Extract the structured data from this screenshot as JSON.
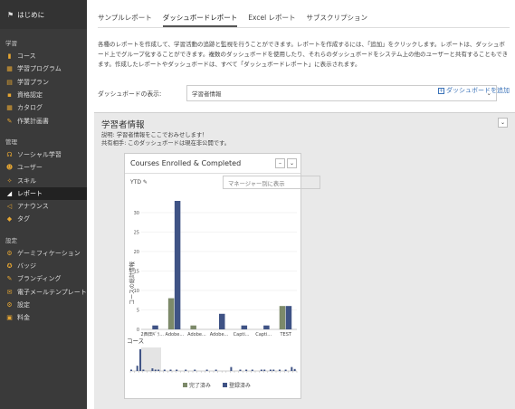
{
  "sidebar": {
    "home_label": "はじめに",
    "sections": [
      {
        "title": "学習",
        "items": [
          {
            "label": "コース",
            "icon": "book-icon"
          },
          {
            "label": "学習プログラム",
            "icon": "program-icon"
          },
          {
            "label": "学習プラン",
            "icon": "plan-icon"
          },
          {
            "label": "資格認定",
            "icon": "certificate-icon"
          },
          {
            "label": "カタログ",
            "icon": "catalog-icon"
          },
          {
            "label": "作業計画書",
            "icon": "pin-icon"
          }
        ]
      },
      {
        "title": "管理",
        "items": [
          {
            "label": "ソーシャル学習",
            "icon": "social-icon"
          },
          {
            "label": "ユーザー",
            "icon": "users-icon"
          },
          {
            "label": "スキル",
            "icon": "skills-icon"
          },
          {
            "label": "レポート",
            "icon": "report-icon",
            "active": true
          },
          {
            "label": "アナウンス",
            "icon": "announce-icon"
          },
          {
            "label": "タグ",
            "icon": "tag-icon"
          }
        ]
      },
      {
        "title": "設定",
        "items": [
          {
            "label": "ゲーミフィケーション",
            "icon": "gamification-icon"
          },
          {
            "label": "バッジ",
            "icon": "badge-icon"
          },
          {
            "label": "ブランディング",
            "icon": "branding-icon"
          },
          {
            "label": "電子メールテンプレート",
            "icon": "email-icon"
          },
          {
            "label": "設定",
            "icon": "settings-icon"
          },
          {
            "label": "料金",
            "icon": "billing-icon"
          }
        ]
      }
    ]
  },
  "tabs": [
    "サンプルレポート",
    "ダッシュボードレポート",
    "Excel レポート",
    "サブスクリプション"
  ],
  "active_tab": 1,
  "description": "各種のレポートを作成して、学習活動の追跡と監視を行うことができます。レポートを作成するには、「追加」をクリックします。レポートは、ダッシュボード上でグループ化することができます。複数のダッシュボードを使用したり、それらのダッシュボードをシステム上の他のユーザーと共有することもできます。作成したレポートやダッシュボードは、すべて「ダッシュボードレポート」に表示されます。",
  "dashboard_select": {
    "label": "ダッシュボードの表示:",
    "value": "学習者情報"
  },
  "add_dashboard": "ダッシュボードを追加",
  "panel": {
    "title": "学習者情報",
    "description": "説明: 学習者情報をここでおみせします！",
    "shared": "共有相手: このダッシュボードは現在非公開です。"
  },
  "widget": {
    "title": "Courses Enrolled & Completed",
    "period": "YTD",
    "filter_placeholder": "マネージャー別に表示"
  },
  "colors": {
    "completed": "#7d8a6a",
    "enrolled": "#3f5385",
    "accent_icon": "#e6a632",
    "link": "#3a72b8"
  },
  "chart_data": {
    "type": "bar",
    "xlabel": "コース",
    "ylabel": "コースの総計情報",
    "ylim": [
      0,
      33
    ],
    "yticks": [
      0,
      5,
      10,
      15,
      20,
      25,
      30
    ],
    "categories": [
      "2西田ｷﾞﾗ...",
      "Adobe...",
      "Adobe...",
      "Adobe...",
      "Capti...",
      "Capti...",
      "TEST"
    ],
    "series": [
      {
        "name": "完了済み",
        "values": [
          0,
          8,
          1,
          0,
          0,
          0,
          6
        ]
      },
      {
        "name": "登録済み",
        "values": [
          1,
          33,
          0,
          4,
          1,
          1,
          6
        ]
      }
    ],
    "navigator_values": [
      1,
      0,
      8,
      33,
      1,
      0,
      0,
      4,
      1,
      1,
      0,
      1,
      0,
      2,
      0,
      1,
      0,
      0,
      1,
      0,
      0,
      1,
      0,
      0,
      0,
      1,
      0,
      0,
      1,
      0,
      0,
      0,
      0,
      6,
      0,
      0,
      1,
      0,
      1,
      0,
      1,
      0,
      0,
      1,
      1,
      0,
      2,
      1,
      0,
      1,
      0,
      1,
      0,
      6,
      3
    ]
  }
}
